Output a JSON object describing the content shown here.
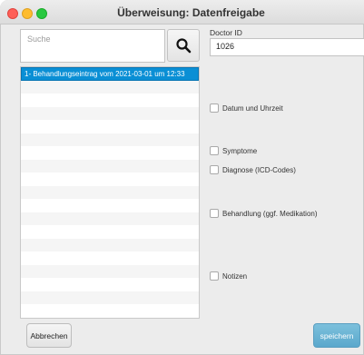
{
  "window": {
    "title": "Überweisung: Datenfreigabe"
  },
  "search": {
    "placeholder": "Suche",
    "value": ""
  },
  "list": {
    "items": [
      "1- Behandlungseintrag vom 2021-03-01 um 12:33",
      "",
      "",
      "",
      "",
      "",
      "",
      "",
      "",
      "",
      "",
      "",
      "",
      "",
      "",
      "",
      "",
      "",
      ""
    ]
  },
  "doctor": {
    "label": "Doctor ID",
    "value": "1026"
  },
  "checkboxes": [
    {
      "label": "Datum und Uhrzeit",
      "checked": false
    },
    {
      "label": "Symptome",
      "checked": false
    },
    {
      "label": "Diagnose (ICD-Codes)",
      "checked": false
    },
    {
      "label": "Behandlung (ggf. Medikation)",
      "checked": false
    },
    {
      "label": "Notizen",
      "checked": false
    }
  ],
  "buttons": {
    "cancel": "Abbrechen",
    "save": "speichern"
  },
  "colors": {
    "selection": "#0a8fd5",
    "save_button": "#6bb5d6"
  }
}
